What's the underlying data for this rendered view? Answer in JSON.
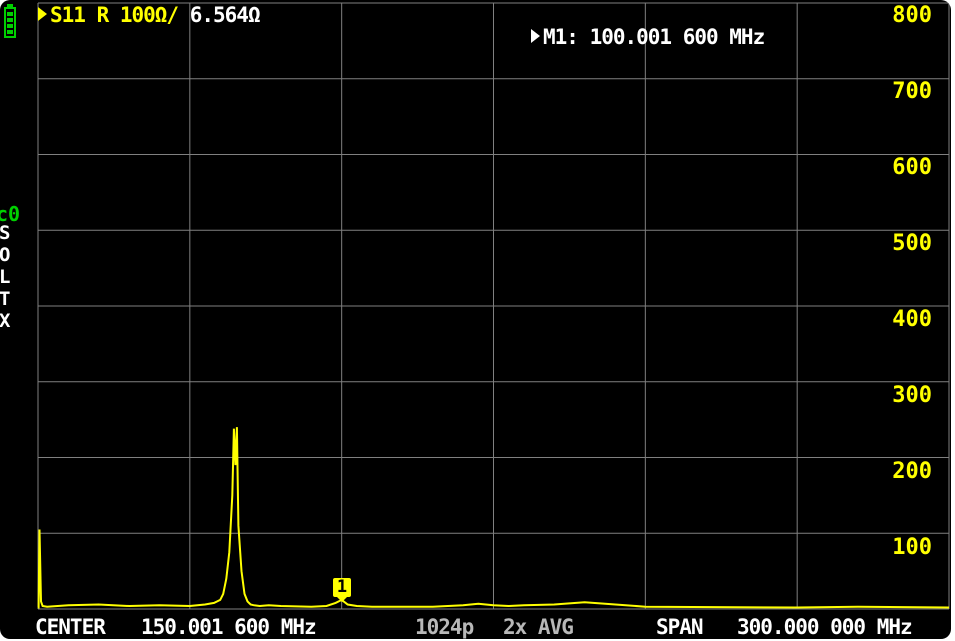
{
  "header": {
    "trace_label": "S11 R 100Ω/",
    "trace_value": "6.564Ω",
    "marker_readout": "M1: 100.001 600 MHz"
  },
  "scale": {
    "labels": [
      "800",
      "700",
      "600",
      "500",
      "400",
      "300",
      "200",
      "100"
    ]
  },
  "cal_menu": {
    "title": "c0",
    "items": [
      "S",
      "O",
      "L",
      "T",
      "X"
    ]
  },
  "marker": {
    "number": "1"
  },
  "footer": {
    "center_label": "CENTER",
    "center_value": "150.001 600 MHz",
    "points": "1024p",
    "averaging": "2x AVG",
    "span_label": "SPAN",
    "span_value": "300.000 000 MHz"
  },
  "colors": {
    "trace": "#ffff00",
    "grid": "#808080",
    "background": "#000000",
    "battery": "#00d000"
  },
  "icons": {
    "battery": "battery-icon",
    "trace_marker": "triangle-right-icon"
  },
  "chart_data": {
    "type": "line",
    "title": "",
    "xlabel": "",
    "ylabel": "",
    "x_range_mhz": [
      0.0016,
      300.0016
    ],
    "ylim": [
      0,
      800
    ],
    "grid": true,
    "series": [
      {
        "x": [
          0.0016,
          0.2,
          0.5,
          1,
          1.5,
          3,
          10,
          20,
          30,
          40,
          50,
          55,
          58,
          60,
          61,
          62,
          63,
          64,
          64.5,
          65,
          65.5,
          66,
          67,
          68,
          69,
          70,
          71,
          73,
          76,
          80,
          90,
          95,
          98,
          100.0016,
          102,
          105,
          110,
          130,
          140,
          145,
          150,
          155,
          160,
          170,
          180,
          200,
          250,
          270,
          300
        ],
        "y": [
          2,
          2,
          105,
          10,
          4,
          3,
          5,
          6,
          4,
          5,
          4,
          6,
          8,
          12,
          20,
          40,
          75,
          150,
          238,
          190,
          240,
          110,
          50,
          20,
          10,
          6,
          5,
          4,
          5,
          4,
          3,
          4,
          8,
          12,
          6,
          4,
          3,
          3,
          5,
          7,
          5,
          4,
          5,
          6,
          9,
          3,
          2,
          3,
          2
        ]
      }
    ]
  }
}
